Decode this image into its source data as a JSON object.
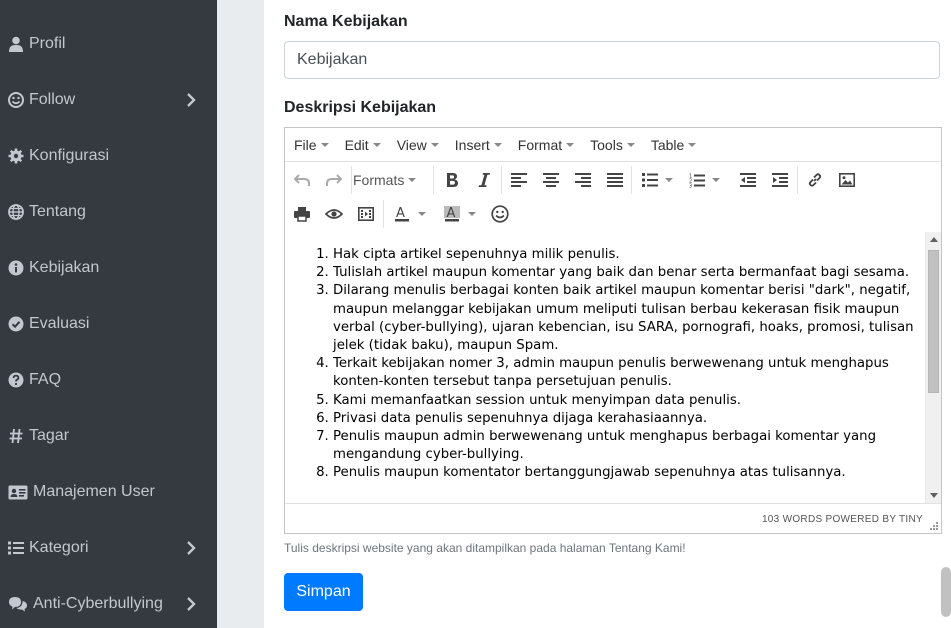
{
  "sidebar": {
    "items": [
      {
        "label": "Profil",
        "icon": "user-icon"
      },
      {
        "label": "Follow",
        "icon": "smile-icon"
      },
      {
        "label": "Konfigurasi",
        "icon": "cog-icon"
      },
      {
        "label": "Tentang",
        "icon": "globe-icon"
      },
      {
        "label": "Kebijakan",
        "icon": "info-circle-icon"
      },
      {
        "label": "Evaluasi",
        "icon": "check-circle-icon"
      },
      {
        "label": "FAQ",
        "icon": "question-circle-icon"
      },
      {
        "label": "Tagar",
        "icon": "hashtag-icon"
      },
      {
        "label": "Manajemen User",
        "icon": "id-card-icon"
      },
      {
        "label": "Kategori",
        "icon": "list-icon"
      },
      {
        "label": "Anti-Cyberbullying",
        "icon": "comments-icon"
      }
    ]
  },
  "form": {
    "name_label": "Nama Kebijakan",
    "name_value": "Kebijakan",
    "desc_label": "Deskripsi Kebijakan",
    "help_text": "Tulis deskripsi website yang akan ditampilkan pada halaman Tentang Kami!",
    "submit_label": "Simpan"
  },
  "editor": {
    "menu": [
      "File",
      "Edit",
      "View",
      "Insert",
      "Format",
      "Tools",
      "Table"
    ],
    "formats_label": "Formats",
    "items": [
      "Hak cipta artikel sepenuhnya milik penulis.",
      "Tulislah artikel maupun komentar yang baik dan benar serta bermanfaat bagi sesama.",
      "Dilarang menulis berbagai konten baik artikel maupun komentar berisi \"dark\", negatif, maupun melanggar kebijakan umum meliputi tulisan berbau kekerasan fisik maupun verbal (cyber-bullying), ujaran kebencian, isu SARA, pornografi, hoaks, promosi, tulisan jelek (tidak baku), maupun Spam.",
      "Terkait kebijakan nomer 3, admin maupun penulis berwewenang untuk menghapus konten-konten tersebut tanpa persetujuan penulis.",
      "Kami memanfaatkan session untuk menyimpan data penulis.",
      "Privasi data penulis sepenuhnya dijaga kerahasiaannya.",
      "Penulis maupun admin berwewenang untuk menghapus berbagai komentar yang mengandung cyber-bullying.",
      "Penulis maupun komentator bertanggungjawab sepenuhnya atas tulisannya."
    ],
    "status": "103 WORDS POWERED BY TINY"
  },
  "colors": {
    "sidebar_bg": "#343a40",
    "primary": "#007bff"
  }
}
